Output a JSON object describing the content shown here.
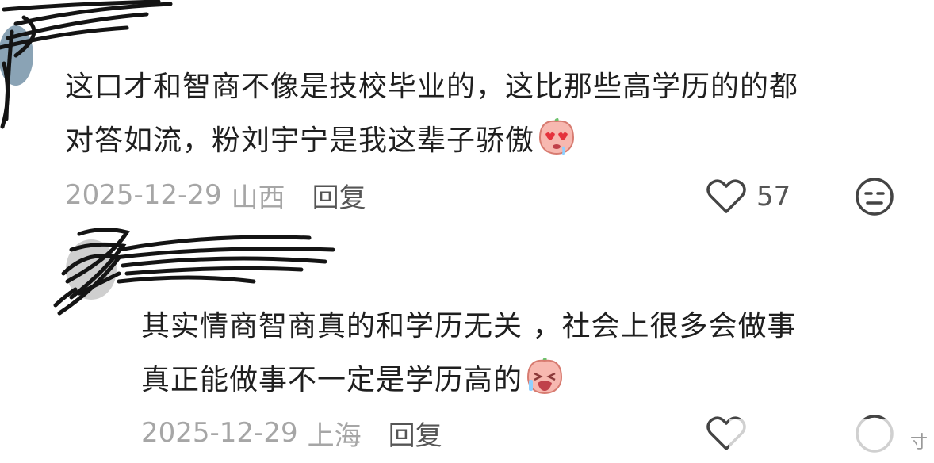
{
  "comments": [
    {
      "text_lines": [
        "这口才和智商不像是技校毕业的，这比那些高学历的的都",
        "对答如流，粉刘宇宁是我这辈子骄傲"
      ],
      "emoji_icon": "peach-heart-eyes-emoji",
      "date": "2025-12-29",
      "location": "山西",
      "reply_label": "回复",
      "like_count": "57"
    },
    {
      "text_lines": [
        "其实情商智商真的和学历无关 ，社会上很多会做事",
        "真正能做事不一定是学历高的"
      ],
      "emoji_icon": "peach-crying-emoji",
      "date": "2025-12-29",
      "location": "上海",
      "reply_label": "回复",
      "like_count": ""
    }
  ],
  "watermark": "寸",
  "colors": {
    "meta_gray": "#a6a6a6",
    "text": "#1f1f1f",
    "redact": "#1a1a1a",
    "peach": "#f7b8b0"
  }
}
